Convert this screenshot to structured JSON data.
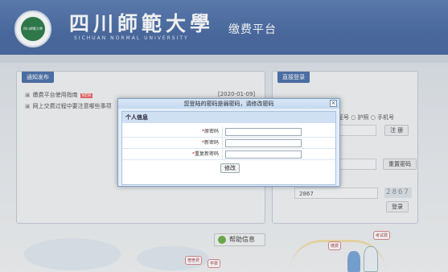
{
  "header": {
    "university_name": "四川師範大學",
    "university_name_en": "SICHUAN NORMAL UNIVERSITY",
    "logo_text": "四川師範大學",
    "platform_title": "缴费平台"
  },
  "notice_panel": {
    "tab_label": "通知发布",
    "items": [
      {
        "title": "缴费平台使用指南",
        "badge": "NEW",
        "date": "[2020-01-09]"
      },
      {
        "title": "网上交费过程中要注意哪些事项",
        "date": ""
      }
    ]
  },
  "login_panel": {
    "tab_label": "直接登录",
    "id_options_partial": "证号 ○ 护照 ○ 手机号",
    "register_label": "注 册",
    "reset_password_label": "重置密码",
    "captcha_value": "2867",
    "captcha_image_text": "2867",
    "login_label": "登录"
  },
  "help": {
    "label": "帮助信息"
  },
  "decor_tags": [
    "缴费",
    "考试费",
    "宿舍费",
    "学费"
  ],
  "dialog": {
    "title": "您登陆的密码是弱密码，请修改密码",
    "close_symbol": "×",
    "section_title": "个人信息",
    "fields": [
      {
        "label": "原密码",
        "required": "*"
      },
      {
        "label": "新密码",
        "required": "*"
      },
      {
        "label": "重复新密码",
        "required": "*"
      }
    ],
    "submit_label": "修改"
  },
  "colors": {
    "header_blue": "#4c6ca3",
    "tab_blue": "#4f73ab",
    "dialog_border": "#7fa1c8"
  }
}
